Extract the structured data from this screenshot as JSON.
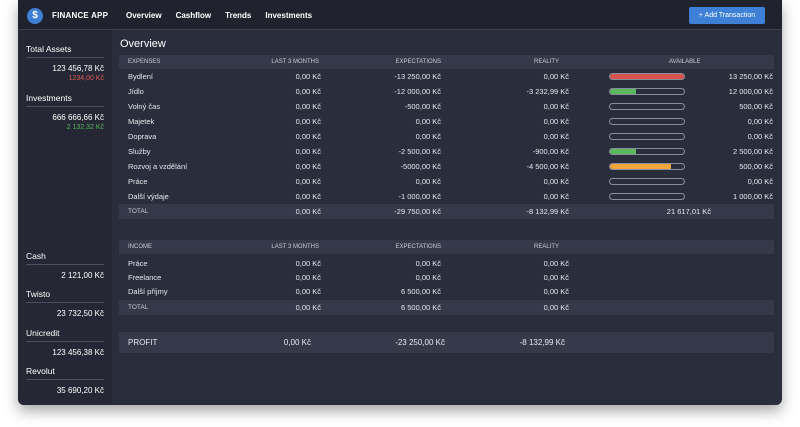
{
  "app": {
    "brand": "FINANCE APP",
    "logo_icon": "dollar-icon"
  },
  "nav": [
    {
      "label": "Overview"
    },
    {
      "label": "Cashflow"
    },
    {
      "label": "Trends"
    },
    {
      "label": "Investments"
    }
  ],
  "add_button": "+ Add Transaction",
  "sidebar": {
    "total_assets": {
      "name": "Total Assets",
      "value": "123 456,78 Kč",
      "sub": "1234,00 Kč"
    },
    "investments": {
      "name": "Investments",
      "value": "666 666,66 Kč",
      "sub": "2 132,32 Kč"
    },
    "cash": {
      "name": "Cash",
      "value": "2 121,00 Kč"
    },
    "twisto": {
      "name": "Twisto",
      "value": "23 732,50 Kč"
    },
    "unicredit": {
      "name": "Unicredit",
      "value": "123 456,38 Kč"
    },
    "revolut": {
      "name": "Revolut",
      "value": "35 690,20 Kč"
    }
  },
  "page_title": "Overview",
  "expenses": {
    "headers": [
      "EXPENSES",
      "LAST 3 MONTHS",
      "EXPECTATIONS",
      "REALITY",
      "AVAILABLE"
    ],
    "rows": [
      {
        "name": "Bydlení",
        "last3": "0,00 Kč",
        "exp": "-13 250,00 Kč",
        "real": "0,00 Kč",
        "avail": "13 250,00 Kč",
        "fill": 1.0,
        "color": "#d9534f"
      },
      {
        "name": "Jídlo",
        "last3": "0,00 Kč",
        "exp": "-12 000,00 Kč",
        "real": "-3 232,99 Kč",
        "avail": "12 000,00 Kč",
        "fill": 0.35,
        "color": "#5cb85c"
      },
      {
        "name": "Volný čas",
        "last3": "0,00 Kč",
        "exp": "-500,00 Kč",
        "real": "0,00 Kč",
        "avail": "500,00 Kč",
        "fill": 0,
        "color": "#5cb85c"
      },
      {
        "name": "Majetek",
        "last3": "0,00 Kč",
        "exp": "0,00 Kč",
        "real": "0,00 Kč",
        "avail": "0,00 Kč",
        "fill": 0,
        "color": "#5cb85c"
      },
      {
        "name": "Doprava",
        "last3": "0,00 Kč",
        "exp": "0,00 Kč",
        "real": "0,00 Kč",
        "avail": "0,00 Kč",
        "fill": 0,
        "color": "#5cb85c"
      },
      {
        "name": "Služby",
        "last3": "0,00 Kč",
        "exp": "-2 500,00 Kč",
        "real": "-900,00 Kč",
        "avail": "2 500,00 Kč",
        "fill": 0.35,
        "color": "#5cb85c"
      },
      {
        "name": "Rozvoj a vzdělání",
        "last3": "0,00 Kč",
        "exp": "-5000,00 Kč",
        "real": "-4 500,00 Kč",
        "avail": "500,00 Kč",
        "fill": 0.82,
        "color": "#f0a63a"
      },
      {
        "name": "Práce",
        "last3": "0,00 Kč",
        "exp": "0,00 Kč",
        "real": "0,00 Kč",
        "avail": "0,00 Kč",
        "fill": 0,
        "color": "#5cb85c"
      },
      {
        "name": "Další výdaje",
        "last3": "0,00 Kč",
        "exp": "-1 000,00 Kč",
        "real": "0,00 Kč",
        "avail": "1 000,00 Kč",
        "fill": 0,
        "color": "#5cb85c"
      }
    ],
    "total": {
      "name": "TOTAL",
      "last3": "0,00 Kč",
      "exp": "-29 750,00 Kč",
      "real": "-8 132,99 Kč",
      "avail": "21 617,01 Kč"
    }
  },
  "income": {
    "headers": [
      "INCOME",
      "LAST 3 MONTHS",
      "EXPECTATIONS",
      "REALITY"
    ],
    "rows": [
      {
        "name": "Práce",
        "last3": "0,00 Kč",
        "exp": "0,00 Kč",
        "real": "0,00 Kč"
      },
      {
        "name": "Freelance",
        "last3": "0,00 Kč",
        "exp": "0,00 Kč",
        "real": "0,00 Kč"
      },
      {
        "name": "Další příjmy",
        "last3": "0,00 Kč",
        "exp": "6 500,00 Kč",
        "real": "0,00 Kč"
      }
    ],
    "total": {
      "name": "TOTAL",
      "last3": "0,00 Kč",
      "exp": "6 500,00 Kč",
      "real": "0,00 Kč"
    }
  },
  "profit": {
    "name": "PROFIT",
    "last3": "0,00 Kč",
    "exp": "-23 250,00 Kč",
    "real": "-8 132,99 Kč"
  }
}
